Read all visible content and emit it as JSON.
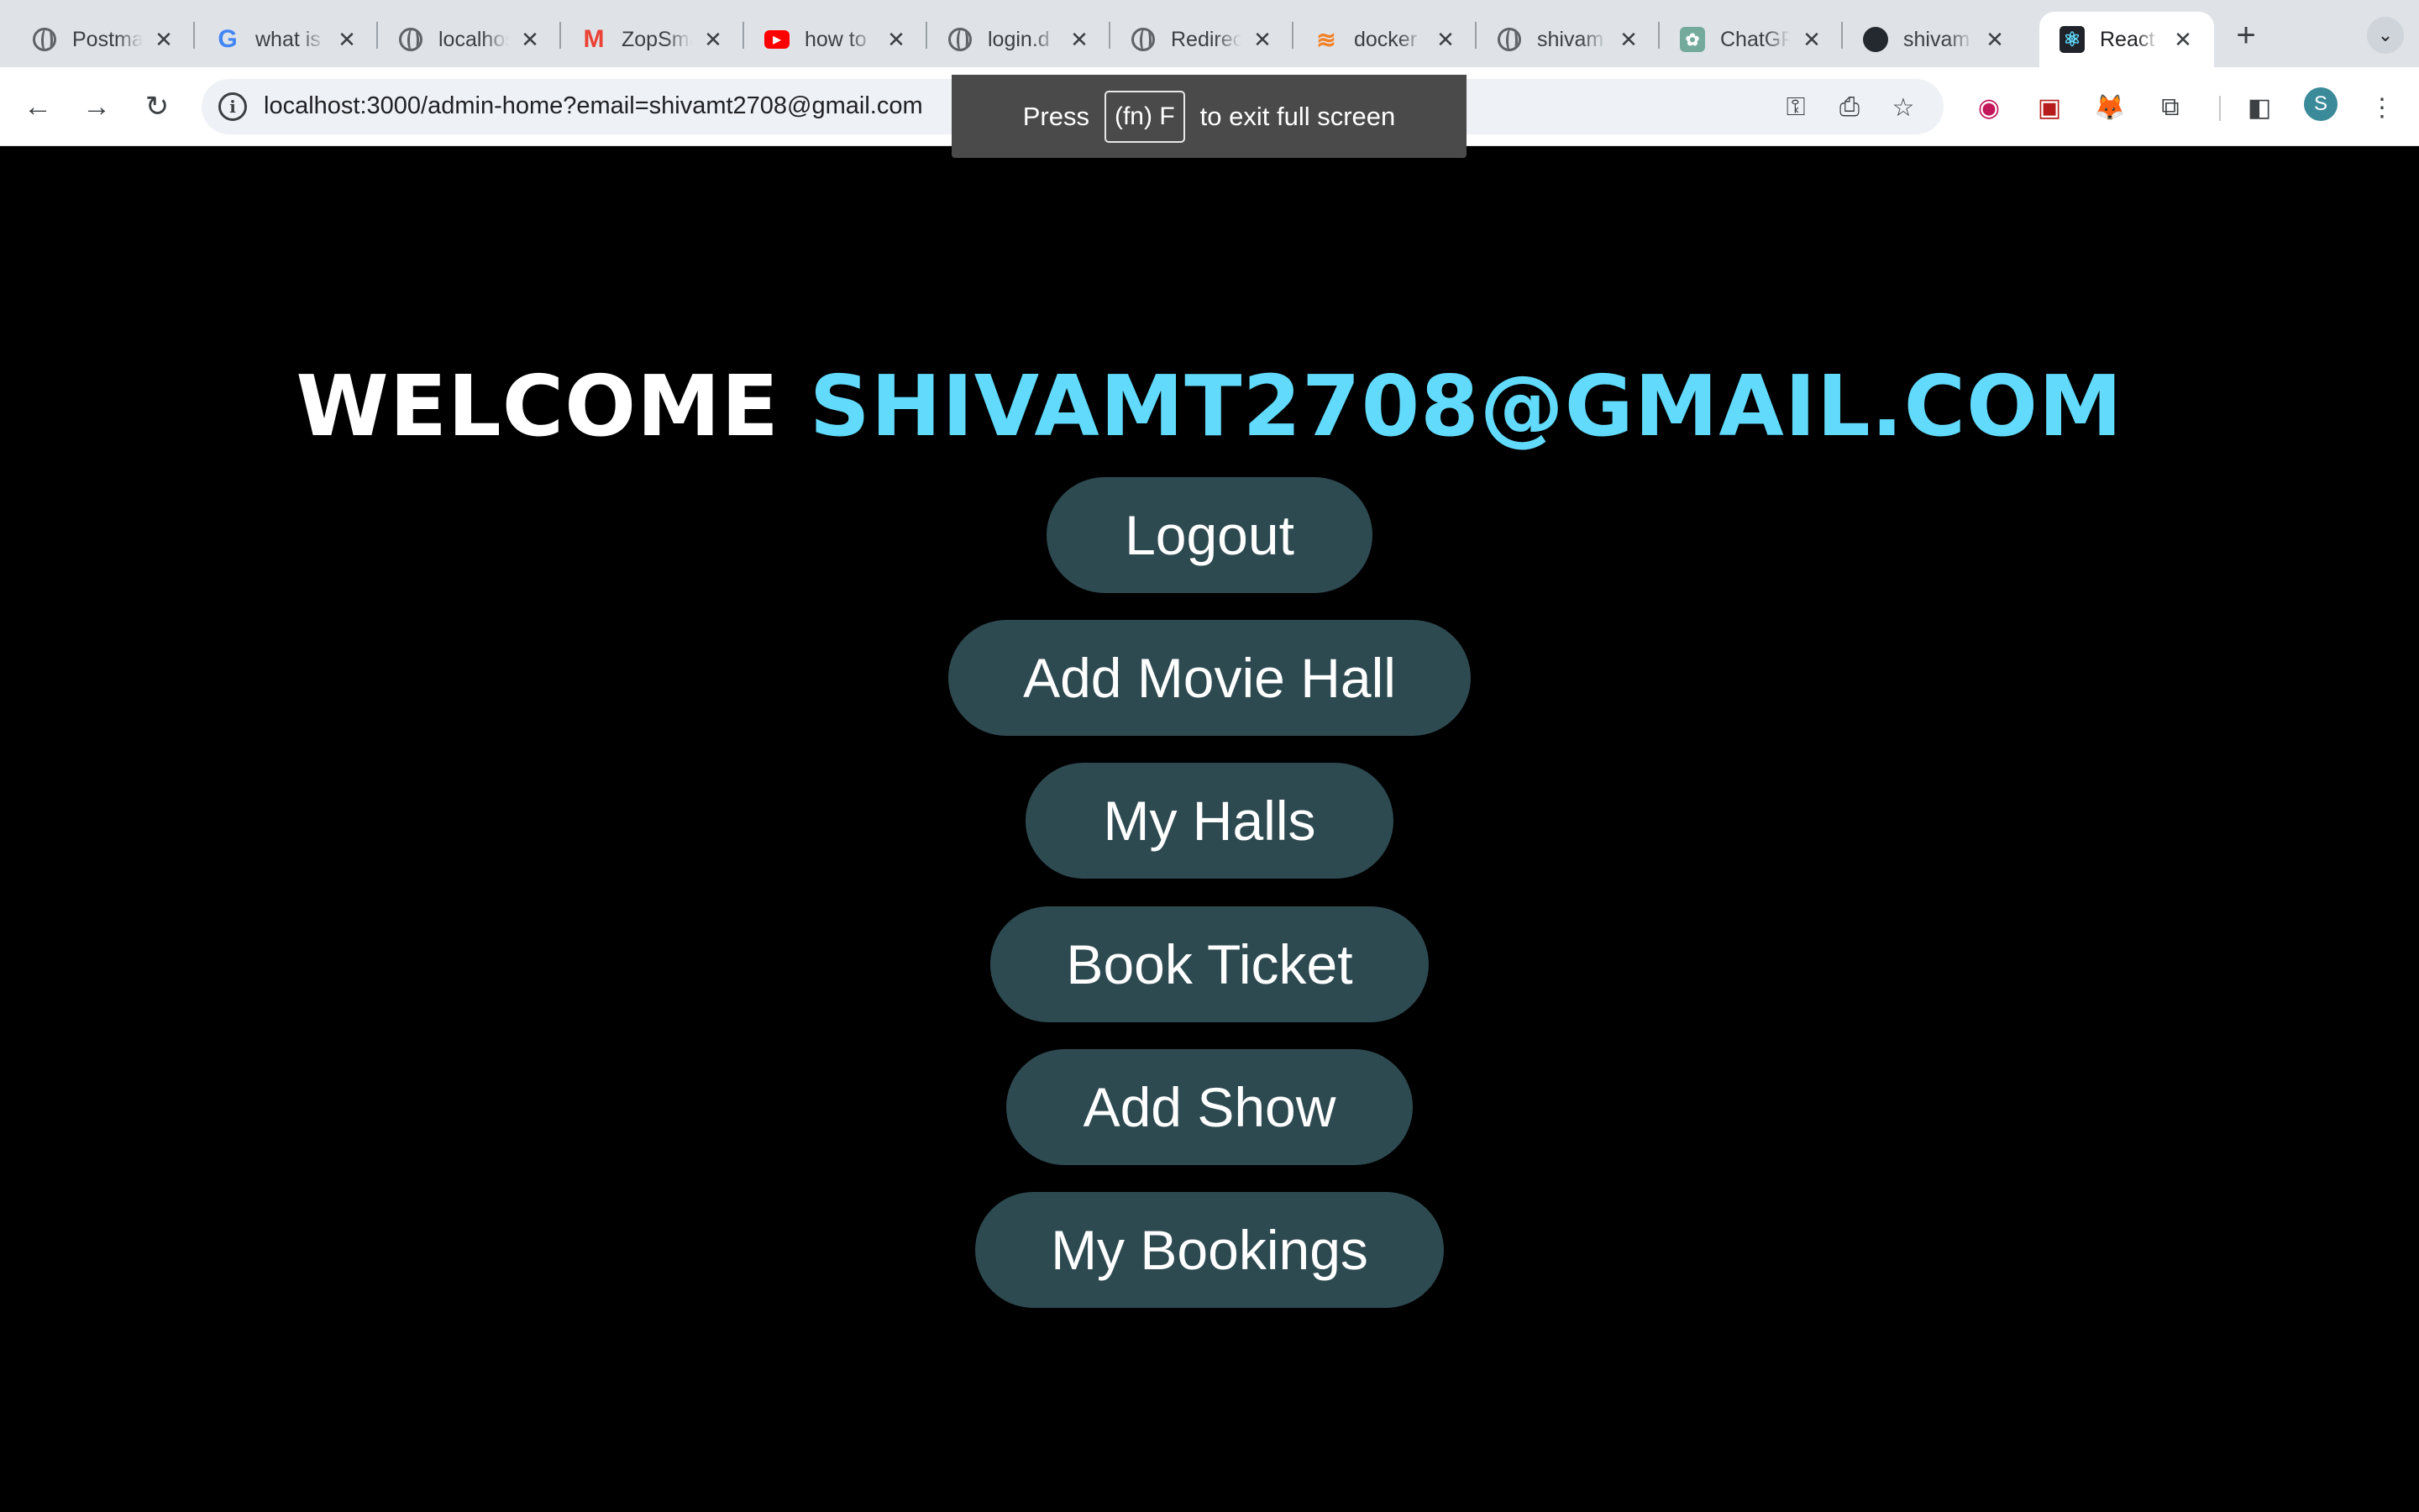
{
  "browser": {
    "tabs": [
      {
        "title": "Postman",
        "favicon": "globe-icon"
      },
      {
        "title": "what is",
        "favicon": "google-icon"
      },
      {
        "title": "localhost",
        "favicon": "globe-icon"
      },
      {
        "title": "ZopSmart",
        "favicon": "gmail-icon"
      },
      {
        "title": "how to",
        "favicon": "youtube-icon"
      },
      {
        "title": "login.d",
        "favicon": "globe-icon"
      },
      {
        "title": "Redirect",
        "favicon": "globe-icon"
      },
      {
        "title": "docker",
        "favicon": "stackoverflow-icon"
      },
      {
        "title": "shivam",
        "favicon": "globe-icon"
      },
      {
        "title": "ChatGPT",
        "favicon": "chatgpt-icon"
      },
      {
        "title": "shivam",
        "favicon": "github-icon"
      },
      {
        "title": "React App",
        "favicon": "react-icon",
        "active": true
      }
    ],
    "new_tab": "+",
    "url": "localhost:3000/admin-home?email=shivamt2708@gmail.com",
    "profile_initial": "S",
    "fullscreen_hint": {
      "prefix": "Press",
      "key": "(fn) F",
      "suffix": "to exit full screen"
    }
  },
  "page": {
    "welcome_word": "WELCOME",
    "email": "SHIVAMT2708@GMAIL.COM",
    "buttons": {
      "logout": "Logout",
      "add_movie_hall": "Add Movie Hall",
      "my_halls": "My Halls",
      "book_ticket": "Book Ticket",
      "add_show": "Add Show",
      "my_bookings": "My Bookings"
    }
  },
  "colors": {
    "page_background": "#000000",
    "button_background": "#2e4a51",
    "email_accent": "#61dafb",
    "welcome_text": "#ffffff"
  }
}
